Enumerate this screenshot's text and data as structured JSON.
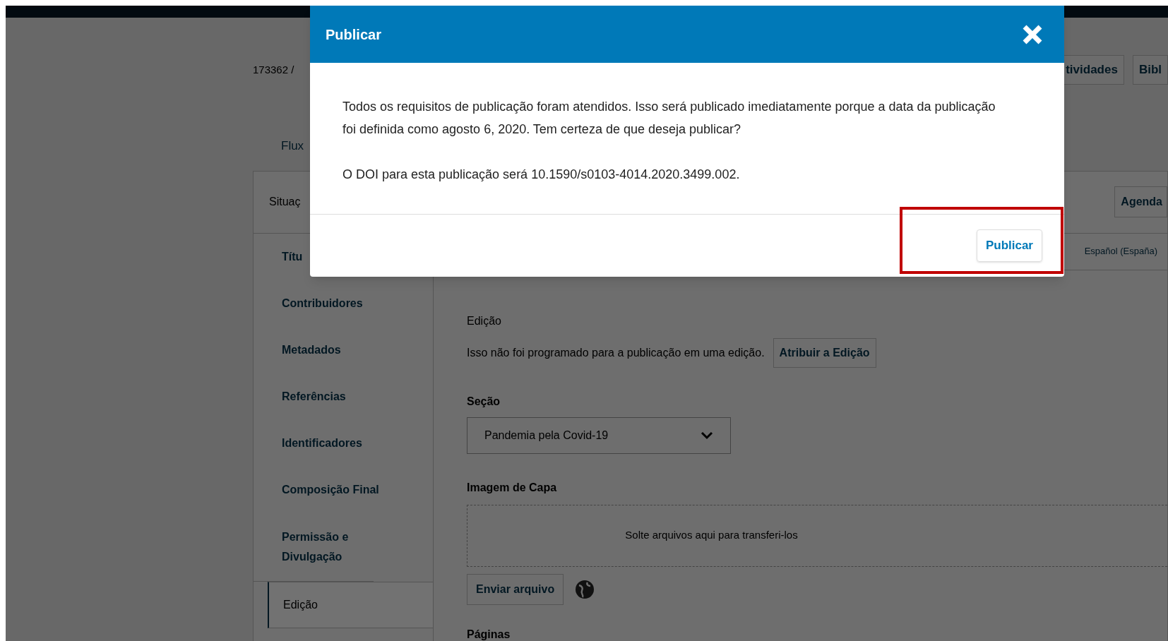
{
  "header": {
    "submission_id": "173362 /",
    "tabs": [
      {
        "label": "tividades"
      },
      {
        "label": "Bibl"
      }
    ]
  },
  "workflow_link": "Flux",
  "panel": {
    "title": "Situaç",
    "action": "Agenda"
  },
  "sidebar": {
    "items": [
      {
        "label": "Títu",
        "selected": false
      },
      {
        "label": "Contribuidores",
        "selected": false
      },
      {
        "label": "Metadados",
        "selected": false
      },
      {
        "label": "Referências",
        "selected": false
      },
      {
        "label": "Identificadores",
        "selected": false
      },
      {
        "label": "Composição Final",
        "selected": false
      },
      {
        "label": "Permissão e Divulgação",
        "selected": false
      },
      {
        "label": "Edição",
        "selected": true
      }
    ]
  },
  "language_tab": "Español (España)",
  "form": {
    "issue": {
      "label": "Edição",
      "text": "Isso não foi programado para a publicação em uma edição.",
      "button": "Atribuir a Edição"
    },
    "section": {
      "label": "Seção",
      "value": "Pandemia pela Covid-19"
    },
    "cover_image": {
      "label": "Imagem de Capa",
      "dropzone": "Solte arquivos aqui para transferi-los",
      "upload_button": "Enviar arquivo"
    },
    "pages_label": "Páginas"
  },
  "dialog": {
    "title": "Publicar",
    "paragraphs": [
      "Todos os requisitos de publicação foram atendidos. Isso será publicado imediatamente porque a data da publicação foi definida como agosto 6, 2020. Tem certeza de que deseja publicar?",
      "O DOI para esta publicação será 10.1590/s0103-4014.2020.3499.002."
    ],
    "button": "Publicar"
  }
}
